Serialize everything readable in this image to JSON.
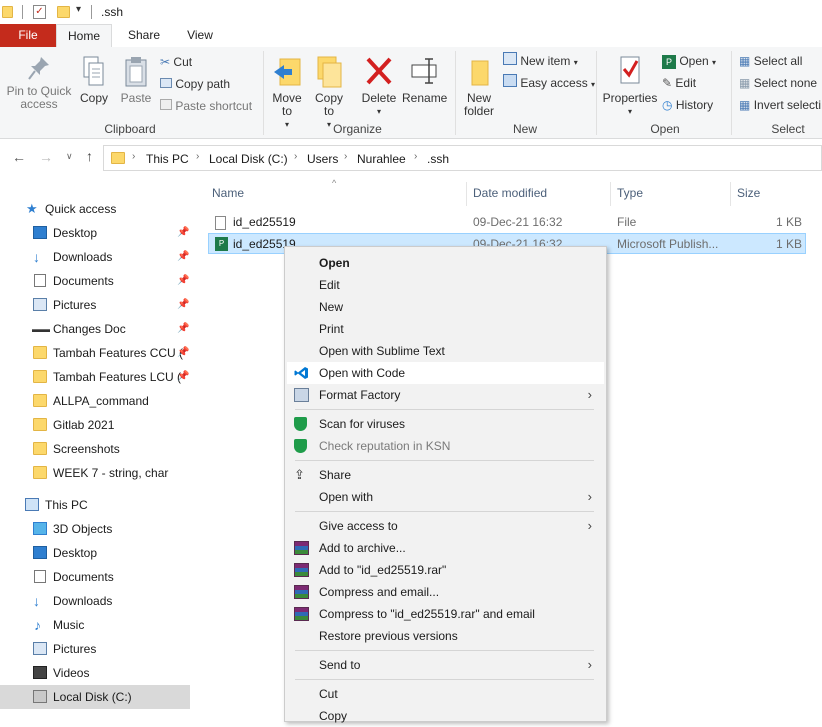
{
  "window": {
    "title": ".ssh"
  },
  "ribbon_tabs": [
    "File",
    "Home",
    "Share",
    "View"
  ],
  "clipboard": {
    "pin": "Pin to Quick\naccess",
    "copy": "Copy",
    "paste": "Paste",
    "cut": "Cut",
    "copy_path": "Copy path",
    "paste_shortcut": "Paste shortcut",
    "label": "Clipboard"
  },
  "organize": {
    "move_to": "Move\nto",
    "copy_to": "Copy\nto",
    "delete": "Delete",
    "rename": "Rename",
    "label": "Organize"
  },
  "new": {
    "new_folder": "New\nfolder",
    "new_item": "New item",
    "easy_access": "Easy access",
    "label": "New"
  },
  "open": {
    "properties": "Properties",
    "open": "Open",
    "edit": "Edit",
    "history": "History",
    "label": "Open"
  },
  "select": {
    "select_all": "Select all",
    "select_none": "Select none",
    "invert": "Invert selecti",
    "label": "Select"
  },
  "breadcrumb": [
    "This PC",
    "Local Disk (C:)",
    "Users",
    "Nurahlee",
    ".ssh"
  ],
  "nav": {
    "quick_access": "Quick access",
    "quick_items": [
      "Desktop",
      "Downloads",
      "Documents",
      "Pictures",
      "Changes Doc",
      "Tambah Features CCU (",
      "Tambah Features LCU (",
      "ALLPA_command",
      "Gitlab 2021",
      "Screenshots",
      "WEEK 7 - string, char"
    ],
    "this_pc": "This PC",
    "pc_items": [
      "3D Objects",
      "Desktop",
      "Documents",
      "Downloads",
      "Music",
      "Pictures",
      "Videos",
      "Local Disk (C:)"
    ]
  },
  "columns": [
    "Name",
    "Date modified",
    "Type",
    "Size"
  ],
  "files": [
    {
      "name": "id_ed25519",
      "date": "09-Dec-21 16:32",
      "type": "File",
      "size": "1 KB"
    },
    {
      "name": "id_ed25519",
      "date": "09-Dec-21 16:32",
      "type": "Microsoft Publish...",
      "size": "1 KB"
    }
  ],
  "context_menu": {
    "open": "Open",
    "edit": "Edit",
    "new": "New",
    "print": "Print",
    "sublime": "Open with Sublime Text",
    "code": "Open with Code",
    "format_factory": "Format Factory",
    "scan": "Scan for viruses",
    "ksn": "Check reputation in KSN",
    "share": "Share",
    "open_with": "Open with",
    "give_access": "Give access to",
    "add_archive": "Add to archive...",
    "add_rar": "Add to \"id_ed25519.rar\"",
    "compress_email": "Compress and email...",
    "compress_rar_email": "Compress to \"id_ed25519.rar\" and email",
    "restore": "Restore previous versions",
    "send_to": "Send to",
    "cut": "Cut",
    "copy": "Copy"
  },
  "colors": {
    "file_tab": "#c42b1c",
    "selection": "#cce8ff",
    "hover": "#ffffff",
    "code_blue": "#0078d4"
  }
}
